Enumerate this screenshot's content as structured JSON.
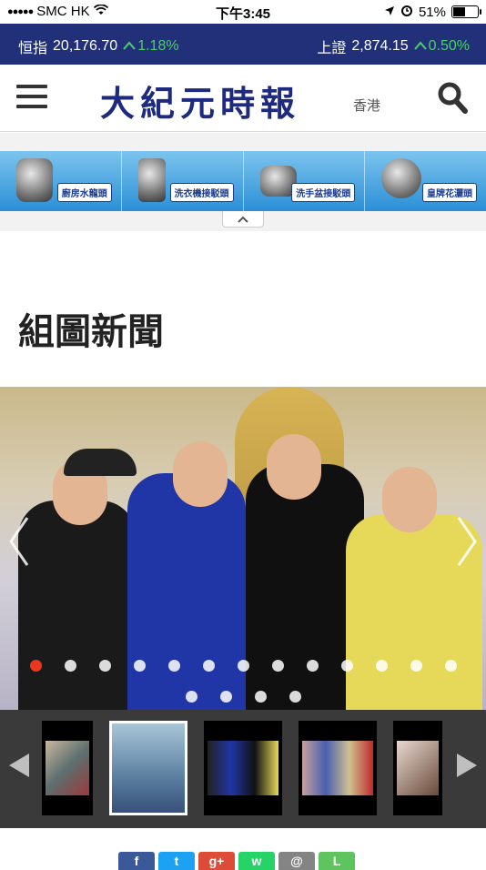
{
  "status_bar": {
    "carrier": "SMC HK",
    "time": "下午3:45",
    "battery": "51%",
    "battery_level": 0.51
  },
  "ticker": {
    "left": {
      "name": "恒指",
      "value": "20,176.70",
      "change": "1.18%"
    },
    "right": {
      "name": "上證",
      "value": "2,874.15",
      "change": "0.50%"
    },
    "up_color": "#4bd06a"
  },
  "header": {
    "logo": "大紀元時報",
    "logo_region": "香港",
    "menu_icon": "hamburger-menu-icon",
    "search_icon": "search-icon",
    "brand_color": "#1e2a7f"
  },
  "ad": {
    "items": [
      {
        "label": "廚房水龍頭"
      },
      {
        "label": "洗衣機接駁頭"
      },
      {
        "label": "洗手盆接駁頭"
      },
      {
        "label": "皇牌花灑頭"
      }
    ],
    "collapse_icon": "chevron-up-icon"
  },
  "section": {
    "title": "組圖新聞"
  },
  "slider": {
    "prev_icon": "chevron-left-icon",
    "next_icon": "chevron-right-icon",
    "dots_row1_count": 13,
    "dots_row2_count": 4,
    "active_dot_index": 0,
    "active_color": "#e8391f"
  },
  "thumbnails": {
    "count": 5,
    "selected_index": 1,
    "prev_icon": "triangle-left-icon",
    "next_icon": "triangle-right-icon"
  },
  "share": {
    "buttons": [
      {
        "name": "facebook",
        "glyph": "f",
        "color": "#3b5998"
      },
      {
        "name": "twitter",
        "glyph": "t",
        "color": "#1da1f2"
      },
      {
        "name": "google-plus",
        "glyph": "g+",
        "color": "#dd4b39"
      },
      {
        "name": "whatsapp",
        "glyph": "w",
        "color": "#25d366"
      },
      {
        "name": "email",
        "glyph": "@",
        "color": "#848484"
      },
      {
        "name": "line",
        "glyph": "L",
        "color": "#5ec45e"
      }
    ]
  }
}
